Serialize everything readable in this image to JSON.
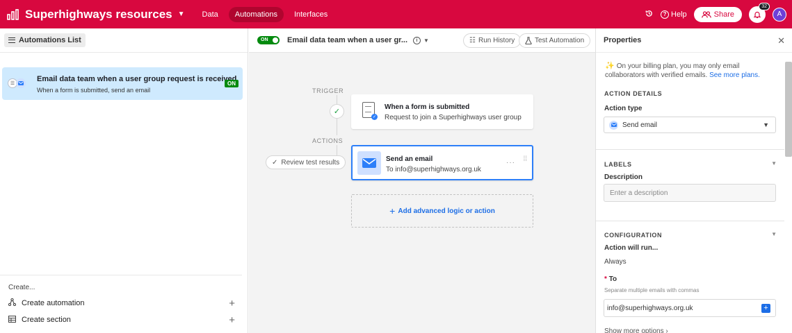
{
  "app": {
    "base_title": "Superhighways resources",
    "nav": [
      {
        "label": "Data",
        "active": false
      },
      {
        "label": "Automations",
        "active": true
      },
      {
        "label": "Interfaces",
        "active": false
      }
    ],
    "help_label": "Help",
    "share_label": "Share",
    "notification_count": "32",
    "avatar_initial": "A",
    "brand_color": "#d8083f"
  },
  "left_panel": {
    "list_button": "Automations List",
    "automation": {
      "title": "Email data team when a user group request is received",
      "subtitle": "When a form is submitted, send an email",
      "status": "ON"
    },
    "create_label": "Create...",
    "create_automation": "Create automation",
    "create_section": "Create section"
  },
  "canvas": {
    "toggle_label": "ON",
    "title": "Email data team when a user gr...",
    "run_history": "Run History",
    "test_automation": "Test Automation",
    "trigger_label": "TRIGGER",
    "actions_label": "ACTIONS",
    "review_label": "Review test results",
    "trigger": {
      "title": "When a form is submitted",
      "subtitle": "Request to join a Superhighways user group"
    },
    "action": {
      "title": "Send an email",
      "subtitle": "To info@superhighways.org.uk",
      "menu": "···"
    },
    "add_logic": "Add advanced logic or action"
  },
  "properties": {
    "title": "Properties",
    "notice_text": "On your billing plan, you may only email collaborators with verified emails.",
    "notice_link": "See more plans.",
    "action_details": "ACTION DETAILS",
    "action_type_label": "Action type",
    "action_type_value": "Send email",
    "labels_section": "LABELS",
    "description_label": "Description",
    "description_placeholder": "Enter a description",
    "configuration_section": "CONFIGURATION",
    "action_will_run_label": "Action will run...",
    "action_will_run_value": "Always",
    "to_required": "*",
    "to_label": "To",
    "to_hint": "Separate multiple emails with commas",
    "to_value": "info@superhighways.org.uk",
    "show_more": "Show more options"
  }
}
